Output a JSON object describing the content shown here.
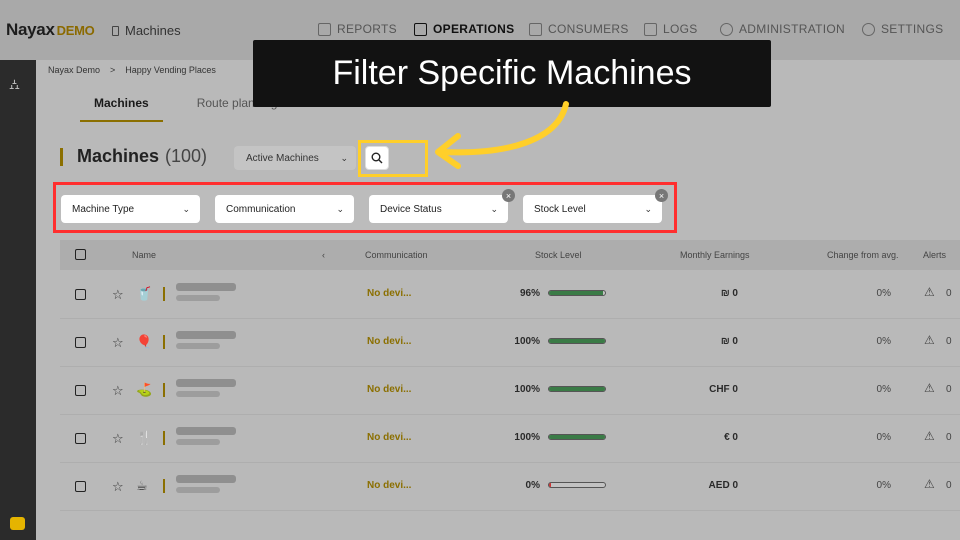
{
  "header": {
    "logo_brand": "Nayax",
    "logo_demo": "DEMO",
    "app_name": "Machines",
    "nav": [
      {
        "label": "REPORTS",
        "icon": "report-icon"
      },
      {
        "label": "OPERATIONS",
        "icon": "operations-icon",
        "active": true
      },
      {
        "label": "CONSUMERS",
        "icon": "consumers-icon"
      },
      {
        "label": "LOGS",
        "icon": "logs-icon"
      },
      {
        "label": "ADMINISTRATION",
        "icon": "admin-icon"
      },
      {
        "label": "SETTINGS",
        "icon": "settings-gear-icon"
      }
    ]
  },
  "breadcrumb": {
    "root": "Nayax Demo",
    "sep": ">",
    "current": "Happy Vending Places"
  },
  "subtabs": {
    "machines": "Machines",
    "route": "Route planning"
  },
  "page": {
    "title": "Machines",
    "count": "(100)",
    "status_select": "Active Machines"
  },
  "filters": {
    "machine_type": "Machine Type",
    "communication": "Communication",
    "device_status": "Device Status",
    "stock_level": "Stock Level"
  },
  "table": {
    "headers": {
      "name": "Name",
      "communication": "Communication",
      "stock": "Stock Level",
      "earnings": "Monthly Earnings",
      "change": "Change from avg.",
      "alerts": "Alerts"
    },
    "rows": [
      {
        "icon": "cup-icon",
        "glyph": "🥤",
        "comm": "No devi...",
        "stock": "96%",
        "stock_fraction": 0.96,
        "earnings": "₪ 0",
        "change": "0%",
        "alerts": "0"
      },
      {
        "icon": "balloon-icon",
        "glyph": "🎈",
        "comm": "No devi...",
        "stock": "100%",
        "stock_fraction": 1.0,
        "earnings": "₪ 0",
        "change": "0%",
        "alerts": "0"
      },
      {
        "icon": "golf-icon",
        "glyph": "⛳",
        "comm": "No devi...",
        "stock": "100%",
        "stock_fraction": 1.0,
        "earnings": "CHF 0",
        "change": "0%",
        "alerts": "0"
      },
      {
        "icon": "cutlery-icon",
        "glyph": "🍴",
        "comm": "No devi...",
        "stock": "100%",
        "stock_fraction": 1.0,
        "earnings": "€ 0",
        "change": "0%",
        "alerts": "0"
      },
      {
        "icon": "coffee-machine-icon",
        "glyph": "☕",
        "comm": "No devi...",
        "stock": "0%",
        "stock_fraction": 0.0,
        "earnings": "AED 0",
        "change": "0%",
        "alerts": "0"
      }
    ]
  },
  "callout": {
    "text": "Filter Specific Machines"
  },
  "colors": {
    "accent": "#8b6f00",
    "highlight": "#ffcf2a",
    "filter_outline": "#ff2e2e",
    "stock_bar": "#3a7b46"
  }
}
